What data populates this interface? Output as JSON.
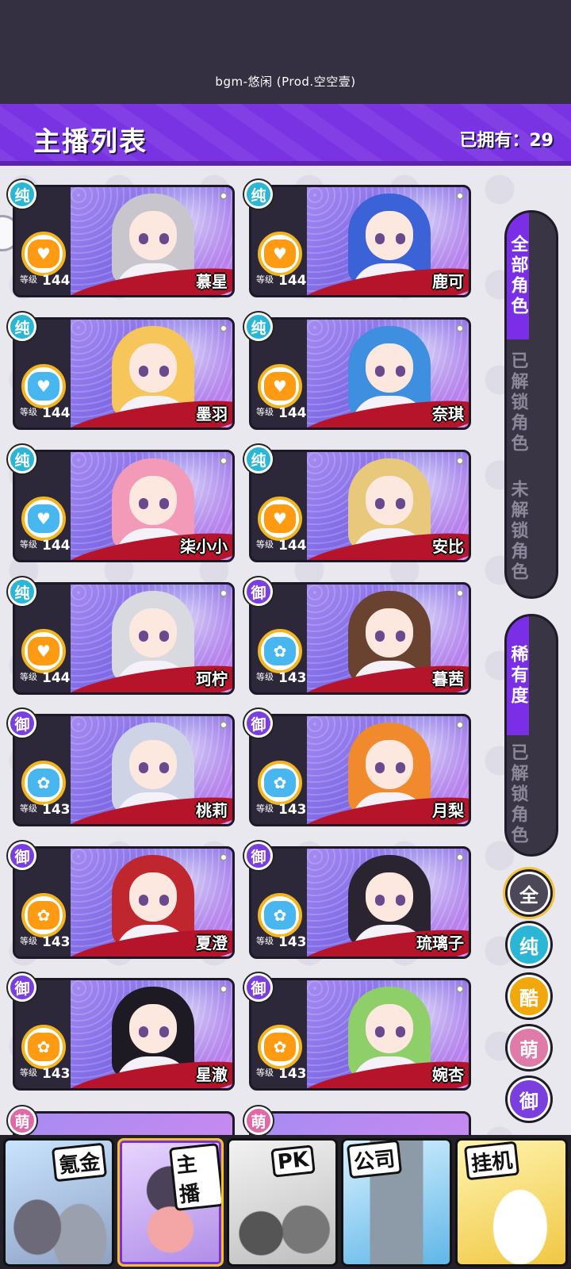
{
  "status": {
    "bgm": "bgm-悠闲 (Prod.空空壹)"
  },
  "header": {
    "title": "主播列表",
    "owned": "已拥有：29"
  },
  "level_label": "等级",
  "streamers": [
    {
      "name": "慕星",
      "level": "144",
      "rarity": "纯",
      "rarity_class": "pure",
      "stat": "orange",
      "stat_glyph": "♥",
      "hair": "#c8c6cc"
    },
    {
      "name": "鹿可",
      "level": "144",
      "rarity": "纯",
      "rarity_class": "pure",
      "stat": "orange",
      "stat_glyph": "♥",
      "hair": "#3b62d6"
    },
    {
      "name": "墨羽",
      "level": "144",
      "rarity": "纯",
      "rarity_class": "pure",
      "stat": "blue",
      "stat_glyph": "♥",
      "hair": "#f6c65a"
    },
    {
      "name": "奈琪",
      "level": "144",
      "rarity": "纯",
      "rarity_class": "pure",
      "stat": "orange",
      "stat_glyph": "♥",
      "hair": "#3f8fe0"
    },
    {
      "name": "柒小小",
      "level": "144",
      "rarity": "纯",
      "rarity_class": "pure",
      "stat": "blue",
      "stat_glyph": "♥",
      "hair": "#f29ab8"
    },
    {
      "name": "安比",
      "level": "144",
      "rarity": "纯",
      "rarity_class": "pure",
      "stat": "orange",
      "stat_glyph": "♥",
      "hair": "#e8c87a"
    },
    {
      "name": "珂柠",
      "level": "144",
      "rarity": "纯",
      "rarity_class": "pure",
      "stat": "orange",
      "stat_glyph": "♥",
      "hair": "#d8dadf"
    },
    {
      "name": "暮茜",
      "level": "143",
      "rarity": "御",
      "rarity_class": "yu",
      "stat": "blue",
      "stat_glyph": "✿",
      "hair": "#6a4330"
    },
    {
      "name": "桃莉",
      "level": "143",
      "rarity": "御",
      "rarity_class": "yu",
      "stat": "blue",
      "stat_glyph": "✿",
      "hair": "#cfd3e6"
    },
    {
      "name": "月梨",
      "level": "143",
      "rarity": "御",
      "rarity_class": "yu",
      "stat": "blue",
      "stat_glyph": "✿",
      "hair": "#f08a2c"
    },
    {
      "name": "夏澄",
      "level": "143",
      "rarity": "御",
      "rarity_class": "yu",
      "stat": "orange",
      "stat_glyph": "✿",
      "hair": "#c0262d"
    },
    {
      "name": "琉璃子",
      "level": "143",
      "rarity": "御",
      "rarity_class": "yu",
      "stat": "blue",
      "stat_glyph": "✿",
      "hair": "#2a2430"
    },
    {
      "name": "星澈",
      "level": "143",
      "rarity": "御",
      "rarity_class": "yu",
      "stat": "orange",
      "stat_glyph": "✿",
      "hair": "#1e1a24"
    },
    {
      "name": "婉杏",
      "level": "143",
      "rarity": "御",
      "rarity_class": "yu",
      "stat": "orange",
      "stat_glyph": "✿",
      "hair": "#8fcf6a"
    }
  ],
  "partial": [
    {
      "rarity": "萌"
    },
    {
      "rarity": "萌"
    }
  ],
  "side": {
    "all_roles": "全部角色",
    "unlocked": "已解锁角色",
    "locked": "未解锁角色",
    "rarity": "稀有度",
    "rarity_unlocked": "已解锁角色"
  },
  "filters": {
    "all": "全",
    "pure": "纯",
    "ku": "酷",
    "meng": "萌",
    "yu": "御"
  },
  "nav": {
    "krypton": "氪金",
    "streamer": "主播",
    "pk": "PK",
    "company": "公司",
    "idle": "挂机"
  }
}
